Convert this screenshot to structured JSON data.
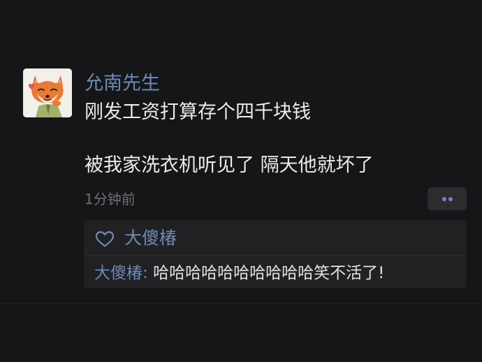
{
  "post": {
    "author": "允南先生",
    "content_lines": [
      "刚发工资打算存个四千块钱",
      "被我家洗衣机听见了 隔天他就坏了"
    ],
    "timestamp": "1分钟前"
  },
  "likes": {
    "names": "大傻椿"
  },
  "comments": [
    {
      "author": "大傻椿",
      "separator": ": ",
      "text": "哈哈哈哈哈哈哈哈哈哈笑不活了!"
    }
  ],
  "icons": {
    "avatar": "fox-avatar",
    "like": "heart-outline-icon",
    "more": "more-dots-icon"
  },
  "colors": {
    "background": "#161618",
    "name_link": "#6d8ab6",
    "text": "#ececec",
    "muted": "#6f6f74",
    "panel": "#212124"
  }
}
